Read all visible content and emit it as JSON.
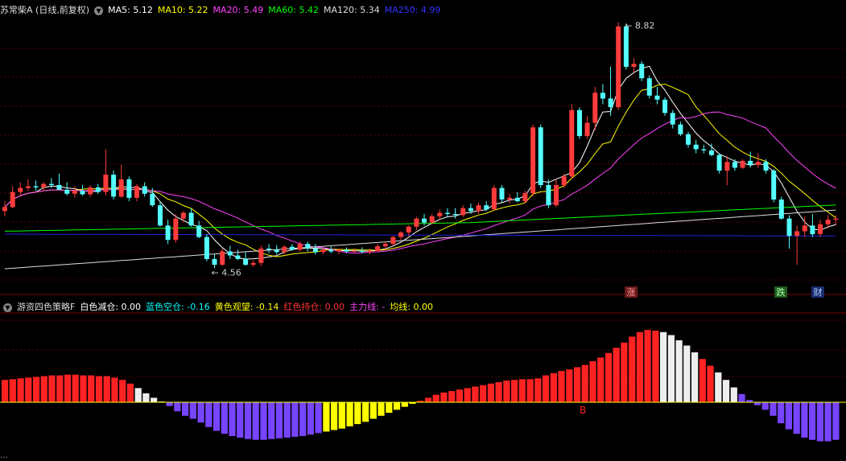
{
  "main_title": {
    "stock": "苏常柴A (日线,前复权)",
    "dropdown_icon": "chevron-down-icon",
    "ma": [
      {
        "label": "MA5: 5.12",
        "color": "#ffffff"
      },
      {
        "label": "MA10: 5.22",
        "color": "#ffff00"
      },
      {
        "label": "MA20: 5.49",
        "color": "#ff44ff"
      },
      {
        "label": "MA60: 5.42",
        "color": "#00ff00"
      },
      {
        "label": "MA120: 5.34",
        "color": "#dddddd"
      },
      {
        "label": "MA250: 4.99",
        "color": "#3333ff"
      }
    ]
  },
  "indicator_title": {
    "name": "游资四色策略F",
    "items": [
      {
        "label": "白色减仓: 0.00",
        "color": "#ffffff"
      },
      {
        "label": "蓝色空仓: -0.16",
        "color": "#00ffff"
      },
      {
        "label": "黄色观望: -0.14",
        "color": "#ffff00"
      },
      {
        "label": "红色持仓: 0.00",
        "color": "#ff3333"
      },
      {
        "label": "主力线: -",
        "color": "#ff44ff"
      },
      {
        "label": "均线: 0.00",
        "color": "#ffff00"
      }
    ]
  },
  "bottom_title": {
    "text": "..."
  },
  "annotations": {
    "high": "8.82",
    "low": "4.56",
    "zhang": "涨",
    "die": "跌",
    "cai": "财",
    "b_marker": "B"
  },
  "colors": {
    "up": "#ff3b3b",
    "down": "#54ffff",
    "grid": "#5a0000",
    "ma250": "#2222dd"
  },
  "chart_data": {
    "type": "candlestick",
    "price_range": [
      4.3,
      8.9
    ],
    "candles": [
      {
        "o": 5.55,
        "h": 5.72,
        "l": 5.46,
        "c": 5.62
      },
      {
        "o": 5.62,
        "h": 5.98,
        "l": 5.6,
        "c": 5.88
      },
      {
        "o": 5.88,
        "h": 6.05,
        "l": 5.8,
        "c": 5.95
      },
      {
        "o": 5.95,
        "h": 6.1,
        "l": 5.9,
        "c": 5.98
      },
      {
        "o": 5.98,
        "h": 6.08,
        "l": 5.9,
        "c": 5.96
      },
      {
        "o": 5.96,
        "h": 6.05,
        "l": 5.9,
        "c": 6.02
      },
      {
        "o": 6.02,
        "h": 6.12,
        "l": 5.95,
        "c": 6.0
      },
      {
        "o": 6.0,
        "h": 6.2,
        "l": 5.95,
        "c": 5.92
      },
      {
        "o": 5.92,
        "h": 6.05,
        "l": 5.82,
        "c": 5.85
      },
      {
        "o": 5.85,
        "h": 5.98,
        "l": 5.78,
        "c": 5.9
      },
      {
        "o": 5.9,
        "h": 6.0,
        "l": 5.82,
        "c": 5.84
      },
      {
        "o": 5.84,
        "h": 6.0,
        "l": 5.8,
        "c": 5.96
      },
      {
        "o": 5.96,
        "h": 6.02,
        "l": 5.85,
        "c": 5.88
      },
      {
        "o": 5.88,
        "h": 6.62,
        "l": 5.82,
        "c": 6.18
      },
      {
        "o": 6.18,
        "h": 6.25,
        "l": 5.75,
        "c": 5.8
      },
      {
        "o": 5.8,
        "h": 6.35,
        "l": 5.78,
        "c": 6.1
      },
      {
        "o": 6.1,
        "h": 6.15,
        "l": 5.72,
        "c": 5.78
      },
      {
        "o": 5.78,
        "h": 6.02,
        "l": 5.72,
        "c": 5.98
      },
      {
        "o": 5.98,
        "h": 6.05,
        "l": 5.8,
        "c": 5.85
      },
      {
        "o": 5.85,
        "h": 5.95,
        "l": 5.62,
        "c": 5.65
      },
      {
        "o": 5.65,
        "h": 5.72,
        "l": 5.28,
        "c": 5.3
      },
      {
        "o": 5.3,
        "h": 5.4,
        "l": 4.98,
        "c": 5.05
      },
      {
        "o": 5.05,
        "h": 5.5,
        "l": 5.0,
        "c": 5.42
      },
      {
        "o": 5.42,
        "h": 5.55,
        "l": 5.35,
        "c": 5.52
      },
      {
        "o": 5.52,
        "h": 5.6,
        "l": 5.28,
        "c": 5.3
      },
      {
        "o": 5.3,
        "h": 5.38,
        "l": 5.08,
        "c": 5.1
      },
      {
        "o": 5.1,
        "h": 5.15,
        "l": 4.68,
        "c": 4.72
      },
      {
        "o": 4.72,
        "h": 4.8,
        "l": 4.56,
        "c": 4.62
      },
      {
        "o": 4.62,
        "h": 4.9,
        "l": 4.6,
        "c": 4.85
      },
      {
        "o": 4.85,
        "h": 4.95,
        "l": 4.72,
        "c": 4.78
      },
      {
        "o": 4.78,
        "h": 4.88,
        "l": 4.7,
        "c": 4.72
      },
      {
        "o": 4.72,
        "h": 4.85,
        "l": 4.6,
        "c": 4.62
      },
      {
        "o": 4.62,
        "h": 4.7,
        "l": 4.58,
        "c": 4.65
      },
      {
        "o": 4.65,
        "h": 4.95,
        "l": 4.6,
        "c": 4.9
      },
      {
        "o": 4.9,
        "h": 4.98,
        "l": 4.82,
        "c": 4.88
      },
      {
        "o": 4.88,
        "h": 4.96,
        "l": 4.8,
        "c": 4.84
      },
      {
        "o": 4.84,
        "h": 4.96,
        "l": 4.8,
        "c": 4.93
      },
      {
        "o": 4.93,
        "h": 4.98,
        "l": 4.86,
        "c": 4.88
      },
      {
        "o": 4.88,
        "h": 5.02,
        "l": 4.85,
        "c": 4.98
      },
      {
        "o": 4.98,
        "h": 5.02,
        "l": 4.85,
        "c": 4.9
      },
      {
        "o": 4.9,
        "h": 4.98,
        "l": 4.8,
        "c": 4.84
      },
      {
        "o": 4.84,
        "h": 4.92,
        "l": 4.8,
        "c": 4.88
      },
      {
        "o": 4.88,
        "h": 4.94,
        "l": 4.82,
        "c": 4.85
      },
      {
        "o": 4.85,
        "h": 4.9,
        "l": 4.8,
        "c": 4.88
      },
      {
        "o": 4.88,
        "h": 4.92,
        "l": 4.82,
        "c": 4.85
      },
      {
        "o": 4.85,
        "h": 4.9,
        "l": 4.82,
        "c": 4.86
      },
      {
        "o": 4.86,
        "h": 4.92,
        "l": 4.82,
        "c": 4.84
      },
      {
        "o": 4.84,
        "h": 4.9,
        "l": 4.8,
        "c": 4.86
      },
      {
        "o": 4.86,
        "h": 4.98,
        "l": 4.84,
        "c": 4.94
      },
      {
        "o": 4.94,
        "h": 5.02,
        "l": 4.88,
        "c": 4.98
      },
      {
        "o": 4.98,
        "h": 5.12,
        "l": 4.95,
        "c": 5.1
      },
      {
        "o": 5.1,
        "h": 5.2,
        "l": 5.05,
        "c": 5.18
      },
      {
        "o": 5.18,
        "h": 5.3,
        "l": 5.12,
        "c": 5.28
      },
      {
        "o": 5.28,
        "h": 5.45,
        "l": 5.22,
        "c": 5.42
      },
      {
        "o": 5.42,
        "h": 5.5,
        "l": 5.3,
        "c": 5.35
      },
      {
        "o": 5.35,
        "h": 5.5,
        "l": 5.32,
        "c": 5.46
      },
      {
        "o": 5.46,
        "h": 5.58,
        "l": 5.4,
        "c": 5.52
      },
      {
        "o": 5.52,
        "h": 5.6,
        "l": 5.45,
        "c": 5.5
      },
      {
        "o": 5.5,
        "h": 5.6,
        "l": 5.42,
        "c": 5.48
      },
      {
        "o": 5.48,
        "h": 5.65,
        "l": 5.45,
        "c": 5.6
      },
      {
        "o": 5.6,
        "h": 5.68,
        "l": 5.5,
        "c": 5.55
      },
      {
        "o": 5.55,
        "h": 5.7,
        "l": 5.5,
        "c": 5.65
      },
      {
        "o": 5.65,
        "h": 5.72,
        "l": 5.55,
        "c": 5.58
      },
      {
        "o": 5.58,
        "h": 6.0,
        "l": 5.55,
        "c": 5.95
      },
      {
        "o": 5.95,
        "h": 6.0,
        "l": 5.7,
        "c": 5.75
      },
      {
        "o": 5.75,
        "h": 5.85,
        "l": 5.68,
        "c": 5.78
      },
      {
        "o": 5.78,
        "h": 5.88,
        "l": 5.7,
        "c": 5.72
      },
      {
        "o": 5.72,
        "h": 5.9,
        "l": 5.68,
        "c": 5.86
      },
      {
        "o": 5.86,
        "h": 7.05,
        "l": 5.8,
        "c": 7.0
      },
      {
        "o": 7.0,
        "h": 7.05,
        "l": 5.95,
        "c": 6.0
      },
      {
        "o": 6.0,
        "h": 6.1,
        "l": 5.6,
        "c": 5.65
      },
      {
        "o": 5.65,
        "h": 6.1,
        "l": 5.62,
        "c": 6.0
      },
      {
        "o": 6.0,
        "h": 6.2,
        "l": 5.95,
        "c": 6.15
      },
      {
        "o": 6.15,
        "h": 7.4,
        "l": 6.1,
        "c": 7.3
      },
      {
        "o": 7.3,
        "h": 7.35,
        "l": 6.8,
        "c": 6.85
      },
      {
        "o": 6.85,
        "h": 7.2,
        "l": 6.8,
        "c": 7.08
      },
      {
        "o": 7.08,
        "h": 7.7,
        "l": 6.95,
        "c": 7.6
      },
      {
        "o": 7.6,
        "h": 7.75,
        "l": 7.4,
        "c": 7.5
      },
      {
        "o": 7.5,
        "h": 8.05,
        "l": 7.2,
        "c": 7.35
      },
      {
        "o": 7.35,
        "h": 8.82,
        "l": 7.3,
        "c": 8.75
      },
      {
        "o": 8.75,
        "h": 8.8,
        "l": 8.0,
        "c": 8.05
      },
      {
        "o": 8.05,
        "h": 8.2,
        "l": 7.95,
        "c": 8.1
      },
      {
        "o": 8.1,
        "h": 8.15,
        "l": 7.8,
        "c": 7.85
      },
      {
        "o": 7.85,
        "h": 7.9,
        "l": 7.5,
        "c": 7.55
      },
      {
        "o": 7.55,
        "h": 7.7,
        "l": 7.4,
        "c": 7.48
      },
      {
        "o": 7.48,
        "h": 7.52,
        "l": 7.2,
        "c": 7.25
      },
      {
        "o": 7.25,
        "h": 7.3,
        "l": 6.98,
        "c": 7.05
      },
      {
        "o": 7.05,
        "h": 7.1,
        "l": 6.85,
        "c": 6.88
      },
      {
        "o": 6.88,
        "h": 6.92,
        "l": 6.65,
        "c": 6.7
      },
      {
        "o": 6.7,
        "h": 6.78,
        "l": 6.55,
        "c": 6.62
      },
      {
        "o": 6.62,
        "h": 6.7,
        "l": 6.55,
        "c": 6.6
      },
      {
        "o": 6.6,
        "h": 6.72,
        "l": 6.5,
        "c": 6.52
      },
      {
        "o": 6.52,
        "h": 6.55,
        "l": 6.2,
        "c": 6.25
      },
      {
        "o": 6.25,
        "h": 6.5,
        "l": 6.0,
        "c": 6.4
      },
      {
        "o": 6.4,
        "h": 6.45,
        "l": 6.25,
        "c": 6.3
      },
      {
        "o": 6.3,
        "h": 6.45,
        "l": 6.28,
        "c": 6.42
      },
      {
        "o": 6.42,
        "h": 6.58,
        "l": 6.3,
        "c": 6.35
      },
      {
        "o": 6.35,
        "h": 6.55,
        "l": 6.3,
        "c": 6.4
      },
      {
        "o": 6.4,
        "h": 6.45,
        "l": 6.2,
        "c": 6.25
      },
      {
        "o": 6.25,
        "h": 6.28,
        "l": 5.7,
        "c": 5.75
      },
      {
        "o": 5.75,
        "h": 5.8,
        "l": 5.4,
        "c": 5.42
      },
      {
        "o": 5.42,
        "h": 5.48,
        "l": 4.9,
        "c": 5.12
      },
      {
        "o": 5.12,
        "h": 5.3,
        "l": 4.62,
        "c": 5.2
      },
      {
        "o": 5.2,
        "h": 5.45,
        "l": 5.1,
        "c": 5.3
      },
      {
        "o": 5.3,
        "h": 5.5,
        "l": 5.1,
        "c": 5.15
      },
      {
        "o": 5.15,
        "h": 5.4,
        "l": 5.1,
        "c": 5.32
      },
      {
        "o": 5.32,
        "h": 5.48,
        "l": 5.25,
        "c": 5.4
      },
      {
        "o": 5.4,
        "h": 5.48,
        "l": 5.3,
        "c": 5.42
      }
    ],
    "indicator": {
      "range": [
        -0.6,
        1.1
      ],
      "values": [
        0.3,
        0.31,
        0.32,
        0.33,
        0.34,
        0.35,
        0.36,
        0.36,
        0.37,
        0.37,
        0.36,
        0.36,
        0.35,
        0.35,
        0.33,
        0.3,
        0.25,
        0.19,
        0.12,
        0.06,
        0.01,
        -0.05,
        -0.12,
        -0.18,
        -0.22,
        -0.27,
        -0.33,
        -0.38,
        -0.42,
        -0.45,
        -0.47,
        -0.49,
        -0.5,
        -0.5,
        -0.49,
        -0.48,
        -0.47,
        -0.46,
        -0.45,
        -0.43,
        -0.41,
        -0.39,
        -0.37,
        -0.35,
        -0.32,
        -0.29,
        -0.26,
        -0.22,
        -0.18,
        -0.14,
        -0.1,
        -0.06,
        -0.02,
        0.02,
        0.06,
        0.1,
        0.13,
        0.15,
        0.17,
        0.19,
        0.21,
        0.23,
        0.25,
        0.27,
        0.29,
        0.3,
        0.31,
        0.31,
        0.32,
        0.36,
        0.39,
        0.42,
        0.44,
        0.47,
        0.5,
        0.55,
        0.6,
        0.66,
        0.73,
        0.8,
        0.88,
        0.94,
        0.97,
        0.96,
        0.94,
        0.9,
        0.83,
        0.76,
        0.67,
        0.58,
        0.49,
        0.4,
        0.3,
        0.2,
        0.11,
        0.03,
        -0.04,
        -0.1,
        -0.18,
        -0.28,
        -0.36,
        -0.42,
        -0.47,
        -0.5,
        -0.52,
        -0.52,
        -0.5
      ],
      "colors": "r,r,r,r,r,r,r,r,r,r,r,r,r,r,r,r,r,w,w,w,w,b,b,b,b,b,b,b,b,b,b,b,b,b,b,b,b,b,b,b,b,y,y,y,y,y,y,y,y,y,y,y,y,r,r,r,r,r,r,r,r,r,r,r,r,r,r,r,r,r,r,r,r,r,r,r,r,r,r,r,r,r,r,r,w,w,w,w,w,r,r,w,w,w,b,b,b,b,b,b,b,b,b,b,b,b,b"
    },
    "ma_lines": [
      {
        "name": "MA5",
        "color": "#ffffff"
      },
      {
        "name": "MA10",
        "color": "#ffff00"
      },
      {
        "name": "MA20",
        "color": "#ff44ff"
      },
      {
        "name": "MA60",
        "color": "#00ff00"
      },
      {
        "name": "MA120",
        "color": "#dddddd"
      },
      {
        "name": "MA250",
        "color": "#2222dd"
      }
    ]
  }
}
